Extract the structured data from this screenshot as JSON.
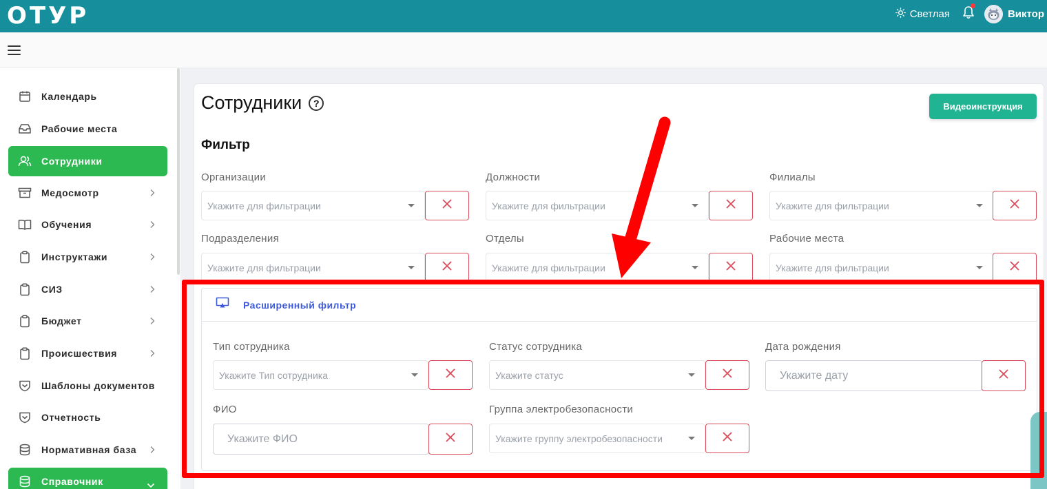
{
  "header": {
    "logo": "ОТУР",
    "theme_label": "Светлая",
    "user_name": "Виктор"
  },
  "sidebar": {
    "items": [
      {
        "label": "Календарь",
        "icon": "calendar-icon",
        "has_chevron": false,
        "active": false
      },
      {
        "label": "Рабочие места",
        "icon": "inbox-icon",
        "has_chevron": false,
        "active": false
      },
      {
        "label": "Сотрудники",
        "icon": "users-icon",
        "has_chevron": false,
        "active": true
      },
      {
        "label": "Медосмотр",
        "icon": "archive-icon",
        "has_chevron": true,
        "active": false
      },
      {
        "label": "Обучения",
        "icon": "book-icon",
        "has_chevron": true,
        "active": false
      },
      {
        "label": "Инструктажи",
        "icon": "clipboard-icon",
        "has_chevron": true,
        "active": false
      },
      {
        "label": "СИЗ",
        "icon": "clipboard-icon",
        "has_chevron": true,
        "active": false
      },
      {
        "label": "Бюджет",
        "icon": "clipboard-icon",
        "has_chevron": true,
        "active": false
      },
      {
        "label": "Происшествия",
        "icon": "clipboard-icon",
        "has_chevron": true,
        "active": false
      },
      {
        "label": "Шаблоны документов",
        "icon": "shield-check-icon",
        "has_chevron": false,
        "active": false
      },
      {
        "label": "Отчетность",
        "icon": "shield-check-icon",
        "has_chevron": false,
        "active": false
      },
      {
        "label": "Нормативная база",
        "icon": "database-icon",
        "has_chevron": true,
        "active": false
      },
      {
        "label": "Справочник",
        "icon": "database-icon",
        "has_chevron": true,
        "active": true
      }
    ]
  },
  "main": {
    "title": "Сотрудники",
    "video_button": "Видеоинструкция",
    "filter_heading": "Фильтр",
    "filters": [
      {
        "label": "Организации",
        "placeholder": "Укажите для фильтрации"
      },
      {
        "label": "Должности",
        "placeholder": "Укажите для фильтрации"
      },
      {
        "label": "Филиалы",
        "placeholder": "Укажите для фильтрации"
      },
      {
        "label": "Подразделения",
        "placeholder": "Укажите для фильтрации"
      },
      {
        "label": "Отделы",
        "placeholder": "Укажите для фильтрации"
      },
      {
        "label": "Рабочие места",
        "placeholder": "Укажите для фильтрации"
      }
    ],
    "advanced": {
      "title": "Расширенный фильтр",
      "fields": [
        {
          "label": "Тип сотрудника",
          "placeholder": "Укажите Тип сотрудника"
        },
        {
          "label": "Статус сотрудника",
          "placeholder": "Укажите статус"
        },
        {
          "label": "Дата рождения",
          "placeholder": "Укажите дату"
        },
        {
          "label": "ФИО",
          "placeholder": "Укажите ФИО"
        },
        {
          "label": "Группа электробезопасности",
          "placeholder": "Укажите группу электробезопасности"
        }
      ]
    }
  },
  "colors": {
    "header_bg": "#168e9c",
    "active_green": "#2db952",
    "video_button": "#20b492",
    "clear_red": "#d94b5a",
    "adv_title": "#3d5bd9",
    "annotation": "#ff0000"
  }
}
